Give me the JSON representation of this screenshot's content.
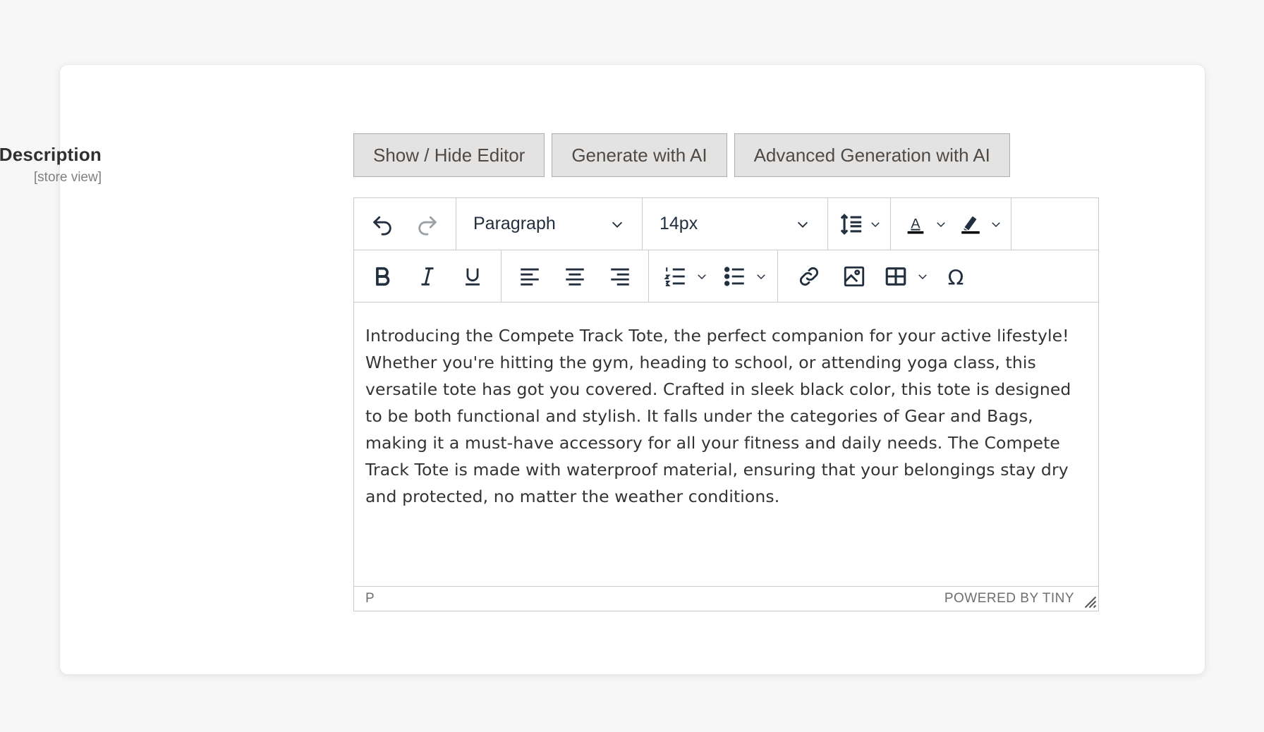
{
  "field": {
    "label": "Short Description",
    "scope": "[store view]"
  },
  "buttons": {
    "show_hide": "Show / Hide Editor",
    "generate": "Generate with AI",
    "advanced": "Advanced Generation with AI"
  },
  "toolbar": {
    "block_format": "Paragraph",
    "font_size": "14px"
  },
  "content": {
    "text": "Introducing the Compete Track Tote, the perfect companion for your active lifestyle! Whether you're hitting the gym, heading to school, or attending yoga class, this versatile tote has got you covered. Crafted in sleek black color, this tote is designed to be both functional and stylish. It falls under the categories of Gear and Bags, making it a must-have accessory for all your fitness and daily needs. The Compete Track Tote is made with waterproof material, ensuring that your belongings stay dry and protected, no matter the weather conditions."
  },
  "statusbar": {
    "path": "P",
    "brand": "POWERED BY TINY"
  },
  "icons": [
    "undo-icon",
    "redo-icon",
    "line-height-icon",
    "text-color-icon",
    "highlight-icon",
    "bold-icon",
    "italic-icon",
    "underline-icon",
    "align-left-icon",
    "align-center-icon",
    "align-right-icon",
    "numbered-list-icon",
    "bullet-list-icon",
    "link-icon",
    "image-icon",
    "table-icon",
    "special-char-icon",
    "resize-handle-icon"
  ],
  "colors": {
    "button_bg": "#e3e3e3",
    "editor_border": "#c9c9c9",
    "icon": "#222f3e"
  }
}
